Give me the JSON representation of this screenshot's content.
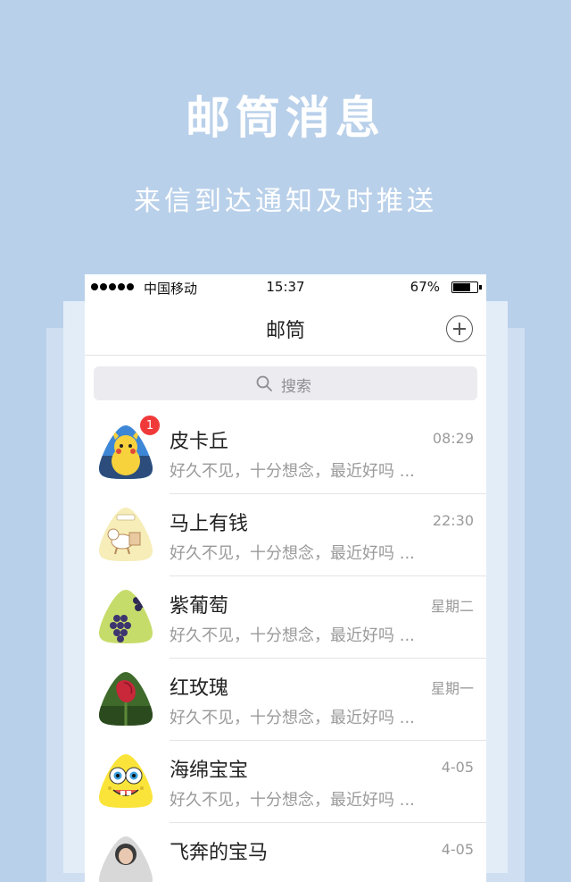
{
  "hero": {
    "title": "邮筒消息",
    "subtitle": "来信到达通知及时推送"
  },
  "status_bar": {
    "carrier": "中国移动",
    "time": "15:37",
    "battery": "67%",
    "battery_level": 0.67
  },
  "navbar": {
    "title": "邮筒",
    "add_icon": "plus-circle-icon"
  },
  "search": {
    "placeholder": "搜索",
    "icon": "search-icon"
  },
  "chats": [
    {
      "name": "皮卡丘",
      "preview": "好久不见，十分想念，最近好吗 ...",
      "time": "08:29",
      "badge": "1",
      "avatar": "pikachu-avatar"
    },
    {
      "name": "马上有钱",
      "preview": "好久不见，十分想念，最近好吗 ...",
      "time": "22:30",
      "avatar": "horse-avatar"
    },
    {
      "name": "紫葡萄",
      "preview": "好久不见，十分想念，最近好吗 ...",
      "time": "星期二",
      "avatar": "grape-avatar"
    },
    {
      "name": "红玫瑰",
      "preview": "好久不见，十分想念，最近好吗 ...",
      "time": "星期一",
      "avatar": "rose-avatar"
    },
    {
      "name": "海绵宝宝",
      "preview": "好久不见，十分想念，最近好吗 ...",
      "time": "4-05",
      "avatar": "spongebob-avatar"
    },
    {
      "name": "飞奔的宝马",
      "preview": "",
      "time": "4-05",
      "avatar": "person-avatar"
    }
  ],
  "colors": {
    "background": "#b9d0ea",
    "badge": "#f03a3a"
  }
}
